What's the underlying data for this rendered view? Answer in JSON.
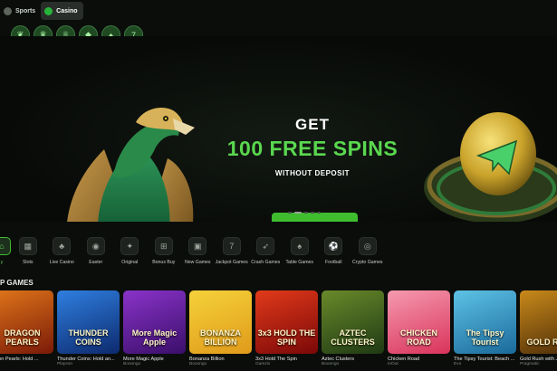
{
  "tabs": [
    {
      "label": "Sports",
      "active": false
    },
    {
      "label": "Casino",
      "active": true
    }
  ],
  "badges": [
    "leaf",
    "crown",
    "crown",
    "gem",
    "hat",
    "seven"
  ],
  "hero": {
    "title_line1": "GET",
    "title_line2": "100 FREE SPINS",
    "subtitle": "WITHOUT DEPOSIT",
    "cta_label": "SIGN UP",
    "accent_color": "#5ad84f",
    "cta_color": "#3fbd2f",
    "slide_count": 5,
    "active_slide": 1
  },
  "categories": [
    {
      "label": "Lobby",
      "display": "y",
      "icon": "home-icon",
      "glyph": "⌂",
      "active": true
    },
    {
      "label": "Slots",
      "icon": "slot-machine-icon",
      "glyph": "▦",
      "active": false
    },
    {
      "label": "Live Casino",
      "icon": "dealer-icon",
      "glyph": "♣",
      "active": false
    },
    {
      "label": "Easter",
      "icon": "egg-icon",
      "glyph": "◉",
      "active": false
    },
    {
      "label": "Original",
      "icon": "original-icon",
      "glyph": "✦",
      "active": false
    },
    {
      "label": "Bonus Buy",
      "icon": "gift-icon",
      "glyph": "⊞",
      "active": false
    },
    {
      "label": "New Games",
      "icon": "new-icon",
      "glyph": "▣",
      "active": false
    },
    {
      "label": "Jackpot Games",
      "icon": "jackpot-icon",
      "glyph": "7",
      "active": false
    },
    {
      "label": "Crash Games",
      "icon": "rocket-icon",
      "glyph": "➶",
      "active": false
    },
    {
      "label": "Table Games",
      "icon": "cards-icon",
      "glyph": "♠",
      "active": false
    },
    {
      "label": "Football",
      "icon": "football-icon",
      "glyph": "⚽",
      "active": false
    },
    {
      "label": "Crypto Games",
      "icon": "crypto-icon",
      "glyph": "◎",
      "active": false
    }
  ],
  "section_title": "P GAMES",
  "games": [
    {
      "name": "ragon Pearls: Hold ...",
      "provider": "",
      "art": "DRAGON PEARLS",
      "c1": "#7a1a08",
      "c2": "#e0761a"
    },
    {
      "name": "Thunder Coins: Hold an...",
      "provider": "Playson",
      "art": "THUNDER COINS",
      "c1": "#0d2a6e",
      "c2": "#2f7fe0"
    },
    {
      "name": "More Magic Apple",
      "provider": "Booongo",
      "art": "More Magic Apple",
      "c1": "#3a0f6a",
      "c2": "#8a33c9"
    },
    {
      "name": "Bonanza Billion",
      "provider": "Booongo",
      "art": "BONANZA BILLION",
      "c1": "#e09a1a",
      "c2": "#f5d23a"
    },
    {
      "name": "3x3 Hold The Spin",
      "provider": "Gamzix",
      "art": "3x3 HOLD THE SPIN",
      "c1": "#7a0808",
      "c2": "#e23a1a"
    },
    {
      "name": "Aztec Clusters",
      "provider": "Booongo",
      "art": "AZTEC CLUSTERS",
      "c1": "#1f3a14",
      "c2": "#6a8a2a"
    },
    {
      "name": "Chicken Road",
      "provider": "InOut",
      "art": "CHICKEN ROAD",
      "c1": "#d9335a",
      "c2": "#f59ab0"
    },
    {
      "name": "The Tipsy Tourist: Beach ...",
      "provider": "Evo",
      "art": "The Tipsy Tourist",
      "c1": "#1a6a9a",
      "c2": "#5ec2e6"
    },
    {
      "name": "Gold Rush with J...",
      "provider": "Pragmatic",
      "art": "GOLD RUSH",
      "c1": "#4a2a08",
      "c2": "#c98a1a"
    }
  ]
}
